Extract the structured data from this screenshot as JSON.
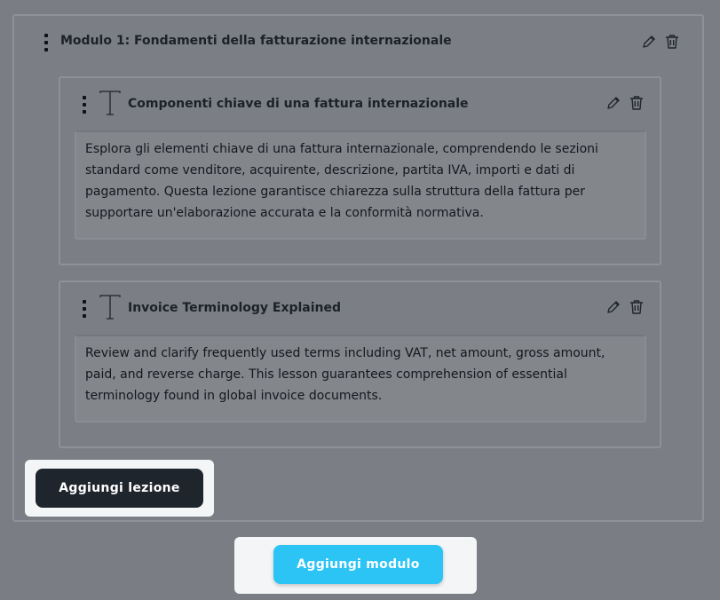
{
  "module": {
    "title": "Modulo 1: Fondamenti della fatturazione internazionale",
    "icons": {
      "drag": "drag-handle-icon",
      "edit": "pencil-icon",
      "delete": "trash-icon"
    }
  },
  "lessons": [
    {
      "icon": "text-type-icon",
      "title": "Componenti chiave di una fattura internazionale",
      "body": "Esplora gli elementi chiave di una fattura internazionale, comprendendo le sezioni standard come venditore, acquirente, descrizione, partita IVA, importi e dati di pagamento. Questa lezione garantisce chiarezza sulla struttura della fattura per supportare un'elaborazione accurata e la conformità normativa."
    },
    {
      "icon": "text-type-icon",
      "title": "Invoice Terminology Explained",
      "body": "Review and clarify frequently used terms including VAT, net amount, gross amount, paid, and reverse charge. This lesson guarantees comprehension of essential terminology found in global invoice documents."
    }
  ],
  "actions": {
    "add_lesson_label": "Aggiungi lezione",
    "add_module_label": "Aggiungi modulo"
  },
  "colors": {
    "overlay": "#7a7e84",
    "primary_dark": "#1f252d",
    "accent": "#2cc3f5"
  }
}
